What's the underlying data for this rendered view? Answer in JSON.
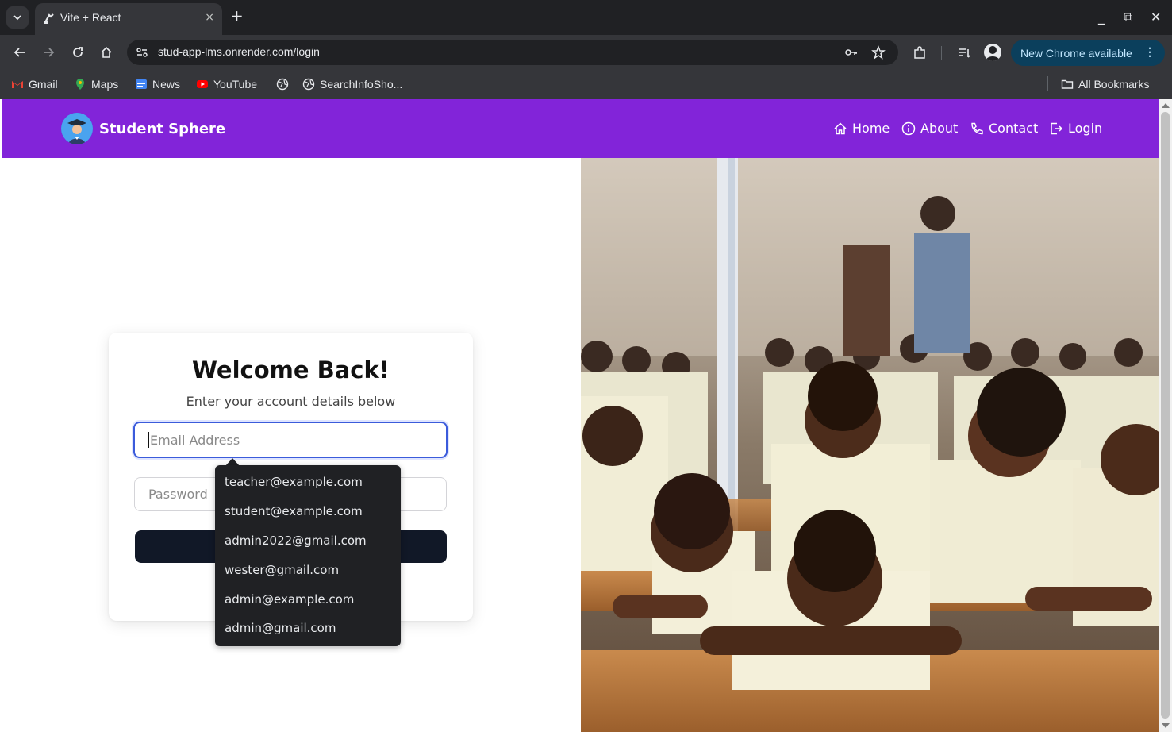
{
  "browser": {
    "tab_title": "Vite + React",
    "tab_close": "×",
    "new_tab": "+",
    "url": "stud-app-lms.onrender.com/login",
    "new_chrome_label": "New Chrome available",
    "new_chrome_menu": "⋮",
    "window_controls": [
      "_",
      "⧉",
      "✕"
    ],
    "bookmarks": [
      "Gmail",
      "Maps",
      "News",
      "YouTube",
      "",
      "SearchInfoSho...",
      "All Bookmarks"
    ]
  },
  "navbar": {
    "brand": "Student Sphere",
    "links": [
      "Home",
      "About",
      "Contact",
      "Login"
    ]
  },
  "login": {
    "title": "Welcome Back!",
    "subtitle": "Enter your account details below",
    "email_placeholder": "Email Address",
    "password_placeholder": "Password",
    "submit_label": ""
  },
  "autofill": {
    "suggestions": [
      "teacher@example.com",
      "student@example.com",
      "admin2022@gmail.com",
      "wester@gmail.com",
      "admin@example.com",
      "admin@gmail.com"
    ]
  },
  "colors": {
    "navbar": "#8224d9",
    "submit": "#111827",
    "focus": "#3b5bdb",
    "chrome_dark": "#202124",
    "chrome_toolbar": "#35363a",
    "new_chrome_bg": "#0b3f5c"
  },
  "icons": [
    "chevron-down-icon",
    "tab-favicon-icon",
    "back-icon",
    "forward-icon",
    "reload-icon",
    "home-icon",
    "site-info-icon",
    "key-icon",
    "star-icon",
    "extensions-icon",
    "reading-list-icon",
    "profile-icon",
    "folder-icon",
    "info-icon",
    "phone-icon",
    "login-icon"
  ]
}
